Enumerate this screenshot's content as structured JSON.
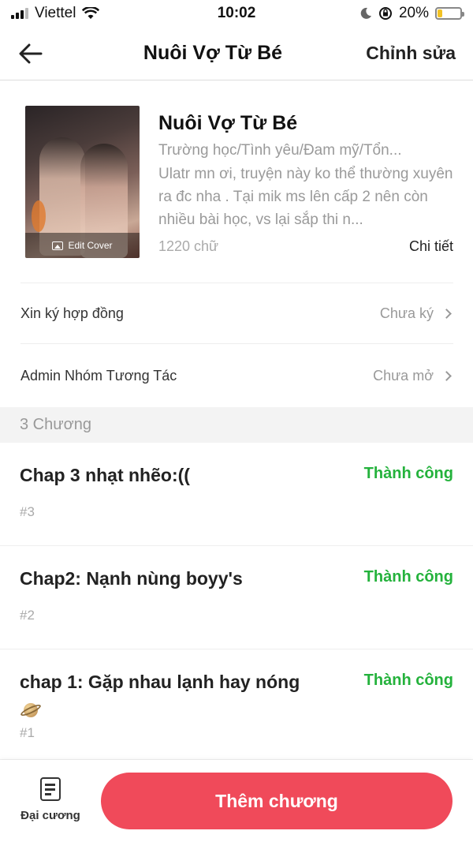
{
  "status_bar": {
    "carrier": "Viettel",
    "time": "10:02",
    "battery": "20%",
    "battery_level": 0.2,
    "icons": [
      "signal-icon",
      "wifi-icon",
      "moon-icon",
      "orientation-lock-icon",
      "battery-icon"
    ]
  },
  "nav": {
    "back_icon": "arrow-left-icon",
    "title": "Nuôi Vợ Từ Bé",
    "edit_label": "Chỉnh sửa"
  },
  "book": {
    "title": "Nuôi Vợ Từ Bé",
    "genre": "Trường học/Tình yêu/Đam mỹ/Tổn...",
    "description": "Ulatr mn ơi, truyện này ko thể thường xuyên ra đc nha . Tại mik ms lên cấp 2 nên còn nhiều bài học, vs lại sắp thi n...",
    "word_count": "1220 chữ",
    "detail_label": "Chi tiết",
    "cover_label": "Edit Cover"
  },
  "rows": {
    "contract": {
      "label": "Xin ký hợp đồng",
      "value": "Chưa ký"
    },
    "admin_group": {
      "label": "Admin Nhóm Tương Tác",
      "value": "Chưa mở"
    }
  },
  "chapters_header": "3 Chương",
  "chapters": [
    {
      "title": "Chap 3 nhạt nhẽo:((",
      "status": "Thành công",
      "number": "#3"
    },
    {
      "title": "Chap2: Nạnh nùng boyy's",
      "status": "Thành công",
      "number": "#2"
    },
    {
      "title": "chap 1: Gặp nhau lạnh hay nóng",
      "emoji_icon": "ringed-planet-icon",
      "status": "Thành công",
      "number": "#1"
    }
  ],
  "bottom_bar": {
    "outline_label": "Đại cương",
    "add_chapter_label": "Thêm chương"
  },
  "colors": {
    "accent": "#f04a5a",
    "success": "#24b23c",
    "muted": "#999999",
    "battery": "#f2c224"
  }
}
